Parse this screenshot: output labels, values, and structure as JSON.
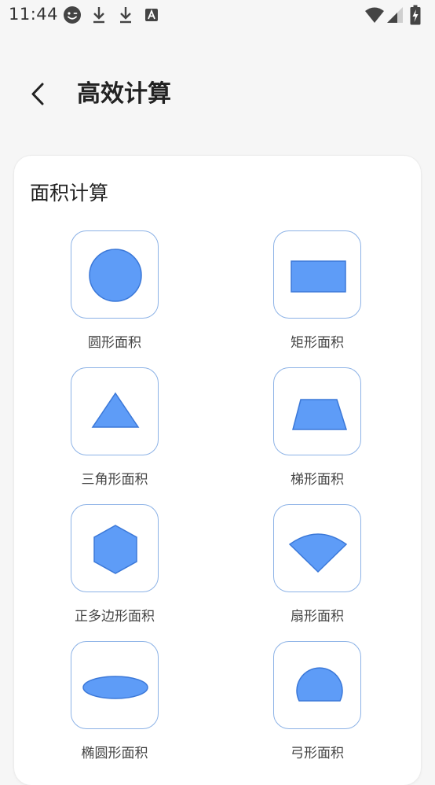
{
  "status_bar": {
    "time": "11:44",
    "left_icons": [
      "smiley-icon",
      "download-icon",
      "download-icon",
      "font-a-icon"
    ],
    "right_icons": [
      "wifi-icon",
      "signal-icon",
      "battery-charging-icon"
    ]
  },
  "header": {
    "back_icon": "chevron-left-icon",
    "title": "高效计算"
  },
  "section": {
    "title": "面积计算",
    "items": [
      {
        "label": "圆形面积",
        "icon": "circle-icon"
      },
      {
        "label": "矩形面积",
        "icon": "rectangle-icon"
      },
      {
        "label": "三角形面积",
        "icon": "triangle-icon"
      },
      {
        "label": "梯形面积",
        "icon": "trapezoid-icon"
      },
      {
        "label": "正多边形面积",
        "icon": "hexagon-icon"
      },
      {
        "label": "扇形面积",
        "icon": "sector-icon"
      },
      {
        "label": "椭圆形面积",
        "icon": "ellipse-icon"
      },
      {
        "label": "弓形面积",
        "icon": "segment-icon"
      }
    ]
  },
  "colors": {
    "shape_fill": "#5e9cf7",
    "shape_stroke": "#3b78d8",
    "tile_border": "#8cb2e6",
    "page_background": "#f6f6f6",
    "card_background": "#ffffff"
  }
}
